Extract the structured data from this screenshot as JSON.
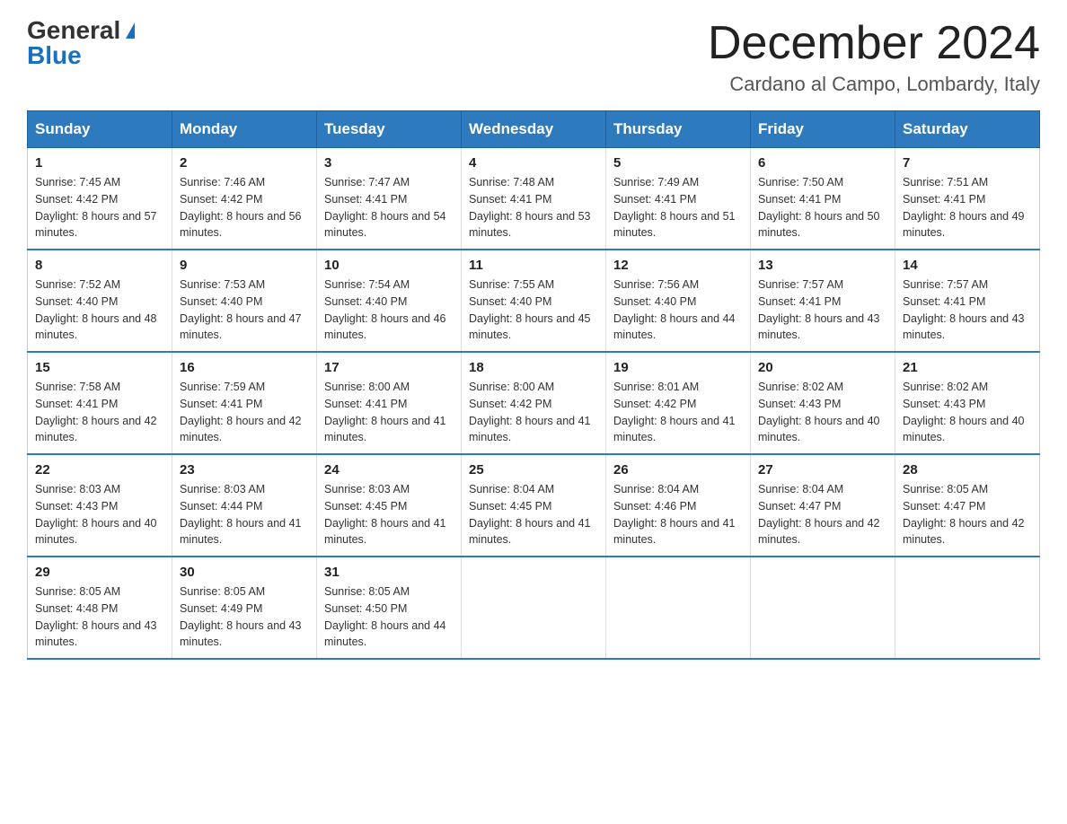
{
  "header": {
    "logo_general": "General",
    "logo_blue": "Blue",
    "title": "December 2024",
    "subtitle": "Cardano al Campo, Lombardy, Italy"
  },
  "weekdays": [
    "Sunday",
    "Monday",
    "Tuesday",
    "Wednesday",
    "Thursday",
    "Friday",
    "Saturday"
  ],
  "weeks": [
    [
      {
        "day": "1",
        "sunrise": "7:45 AM",
        "sunset": "4:42 PM",
        "daylight": "8 hours and 57 minutes."
      },
      {
        "day": "2",
        "sunrise": "7:46 AM",
        "sunset": "4:42 PM",
        "daylight": "8 hours and 56 minutes."
      },
      {
        "day": "3",
        "sunrise": "7:47 AM",
        "sunset": "4:41 PM",
        "daylight": "8 hours and 54 minutes."
      },
      {
        "day": "4",
        "sunrise": "7:48 AM",
        "sunset": "4:41 PM",
        "daylight": "8 hours and 53 minutes."
      },
      {
        "day": "5",
        "sunrise": "7:49 AM",
        "sunset": "4:41 PM",
        "daylight": "8 hours and 51 minutes."
      },
      {
        "day": "6",
        "sunrise": "7:50 AM",
        "sunset": "4:41 PM",
        "daylight": "8 hours and 50 minutes."
      },
      {
        "day": "7",
        "sunrise": "7:51 AM",
        "sunset": "4:41 PM",
        "daylight": "8 hours and 49 minutes."
      }
    ],
    [
      {
        "day": "8",
        "sunrise": "7:52 AM",
        "sunset": "4:40 PM",
        "daylight": "8 hours and 48 minutes."
      },
      {
        "day": "9",
        "sunrise": "7:53 AM",
        "sunset": "4:40 PM",
        "daylight": "8 hours and 47 minutes."
      },
      {
        "day": "10",
        "sunrise": "7:54 AM",
        "sunset": "4:40 PM",
        "daylight": "8 hours and 46 minutes."
      },
      {
        "day": "11",
        "sunrise": "7:55 AM",
        "sunset": "4:40 PM",
        "daylight": "8 hours and 45 minutes."
      },
      {
        "day": "12",
        "sunrise": "7:56 AM",
        "sunset": "4:40 PM",
        "daylight": "8 hours and 44 minutes."
      },
      {
        "day": "13",
        "sunrise": "7:57 AM",
        "sunset": "4:41 PM",
        "daylight": "8 hours and 43 minutes."
      },
      {
        "day": "14",
        "sunrise": "7:57 AM",
        "sunset": "4:41 PM",
        "daylight": "8 hours and 43 minutes."
      }
    ],
    [
      {
        "day": "15",
        "sunrise": "7:58 AM",
        "sunset": "4:41 PM",
        "daylight": "8 hours and 42 minutes."
      },
      {
        "day": "16",
        "sunrise": "7:59 AM",
        "sunset": "4:41 PM",
        "daylight": "8 hours and 42 minutes."
      },
      {
        "day": "17",
        "sunrise": "8:00 AM",
        "sunset": "4:41 PM",
        "daylight": "8 hours and 41 minutes."
      },
      {
        "day": "18",
        "sunrise": "8:00 AM",
        "sunset": "4:42 PM",
        "daylight": "8 hours and 41 minutes."
      },
      {
        "day": "19",
        "sunrise": "8:01 AM",
        "sunset": "4:42 PM",
        "daylight": "8 hours and 41 minutes."
      },
      {
        "day": "20",
        "sunrise": "8:02 AM",
        "sunset": "4:43 PM",
        "daylight": "8 hours and 40 minutes."
      },
      {
        "day": "21",
        "sunrise": "8:02 AM",
        "sunset": "4:43 PM",
        "daylight": "8 hours and 40 minutes."
      }
    ],
    [
      {
        "day": "22",
        "sunrise": "8:03 AM",
        "sunset": "4:43 PM",
        "daylight": "8 hours and 40 minutes."
      },
      {
        "day": "23",
        "sunrise": "8:03 AM",
        "sunset": "4:44 PM",
        "daylight": "8 hours and 41 minutes."
      },
      {
        "day": "24",
        "sunrise": "8:03 AM",
        "sunset": "4:45 PM",
        "daylight": "8 hours and 41 minutes."
      },
      {
        "day": "25",
        "sunrise": "8:04 AM",
        "sunset": "4:45 PM",
        "daylight": "8 hours and 41 minutes."
      },
      {
        "day": "26",
        "sunrise": "8:04 AM",
        "sunset": "4:46 PM",
        "daylight": "8 hours and 41 minutes."
      },
      {
        "day": "27",
        "sunrise": "8:04 AM",
        "sunset": "4:47 PM",
        "daylight": "8 hours and 42 minutes."
      },
      {
        "day": "28",
        "sunrise": "8:05 AM",
        "sunset": "4:47 PM",
        "daylight": "8 hours and 42 minutes."
      }
    ],
    [
      {
        "day": "29",
        "sunrise": "8:05 AM",
        "sunset": "4:48 PM",
        "daylight": "8 hours and 43 minutes."
      },
      {
        "day": "30",
        "sunrise": "8:05 AM",
        "sunset": "4:49 PM",
        "daylight": "8 hours and 43 minutes."
      },
      {
        "day": "31",
        "sunrise": "8:05 AM",
        "sunset": "4:50 PM",
        "daylight": "8 hours and 44 minutes."
      },
      null,
      null,
      null,
      null
    ]
  ]
}
